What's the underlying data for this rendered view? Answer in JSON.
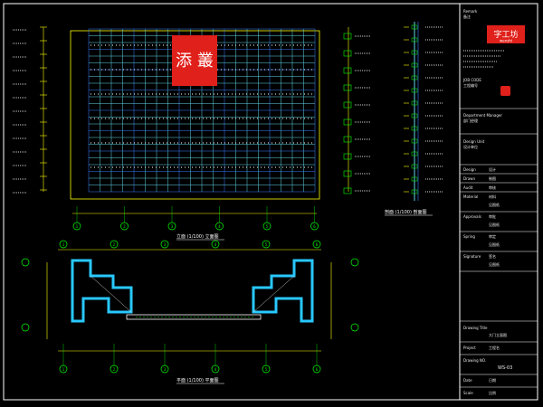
{
  "colors": {
    "background": "#000000",
    "frame": "#ffffff",
    "grid_cyan": "#5fd6e6",
    "grid_blue": "#3a7dff",
    "dimension_yellow": "#ffff00",
    "axis_green": "#00ff00",
    "accent_red": "#e0201a",
    "glass_cyan": "#28c8ff"
  },
  "elevation_view": {
    "sign_characters": "添 叢",
    "title": "立面 (1/100) 立面图",
    "scale": "1:100"
  },
  "plan_view": {
    "title": "平面 (1/100) 平面图",
    "scale": "1:100"
  },
  "section_view": {
    "title": "剖面 (1/100) 剖面图",
    "scale": "1:100"
  },
  "axis_labels_elevation": [
    "1",
    "2",
    "3",
    "4",
    "5",
    "6"
  ],
  "axis_labels_plan": [
    "1",
    "2",
    "3",
    "4",
    "5",
    "6"
  ],
  "title_block": {
    "logo_text": "字工坊",
    "logo_subtext": "wenzhi",
    "company_label": "Remark",
    "company_note": "备注",
    "job_label": "JOB CODE",
    "job_value": "工程编号",
    "department_label": "Department Manager",
    "department_value": "部门经理",
    "design_unit_label": "Design Unit",
    "design_unit_value": "设计单位",
    "rows": [
      {
        "label": "Design",
        "value": "设计"
      },
      {
        "label": "Drawn",
        "value": "制图"
      },
      {
        "label": "Audit",
        "value": "审核"
      },
      {
        "label": "Material",
        "value": "材料"
      },
      {
        "label": "Approvals",
        "value": "审批"
      },
      {
        "label": "Spring",
        "value": "审定"
      },
      {
        "label": "Signature",
        "value": "签名"
      }
    ],
    "approval_stamp": "见图纸",
    "drawing_title_label": "Drawing Title",
    "drawing_title_value": "大门立面图",
    "project_label": "Project",
    "project_value": "工程名",
    "drawing_no_label": "Drawing NO.",
    "drawing_no_value": "WS-03",
    "date_label": "Date",
    "date_value": "日期",
    "scale_label": "Scale",
    "scale_value": "比例"
  }
}
